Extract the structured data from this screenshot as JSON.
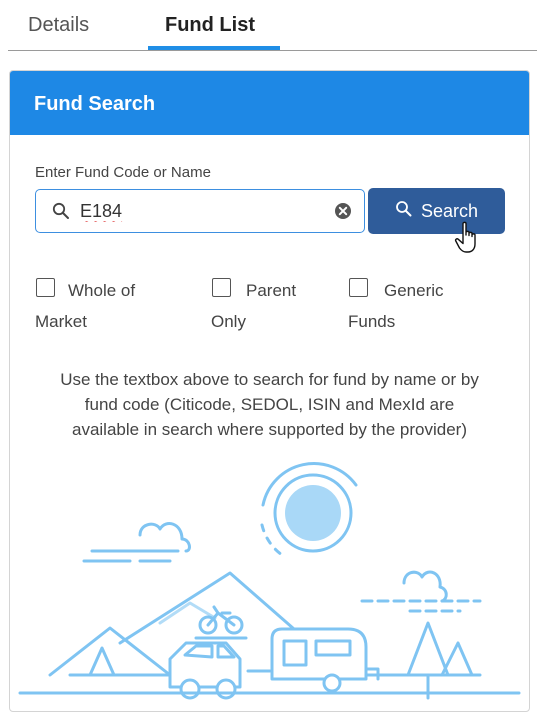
{
  "tabs": {
    "details": "Details",
    "fund_list": "Fund List",
    "active": "fund_list"
  },
  "panel": {
    "title": "Fund Search"
  },
  "search": {
    "label": "Enter Fund Code or Name",
    "value": "E184",
    "button_label": "Search"
  },
  "checkboxes": [
    {
      "line1": "Whole of",
      "line2": "Market",
      "checked": false
    },
    {
      "line1": "Parent",
      "line2": "Only",
      "checked": false
    },
    {
      "line1": "Generic",
      "line2": "Funds",
      "checked": false
    }
  ],
  "help_lines": [
    "Use the textbox above to search for fund by name or by",
    "fund code (Citicode, SEDOL, ISIN and MexId are",
    "available in search where supported by the provider)"
  ],
  "colors": {
    "accent": "#1e88e5",
    "button": "#2f5c9a",
    "illustration": "#7fc4f2"
  }
}
